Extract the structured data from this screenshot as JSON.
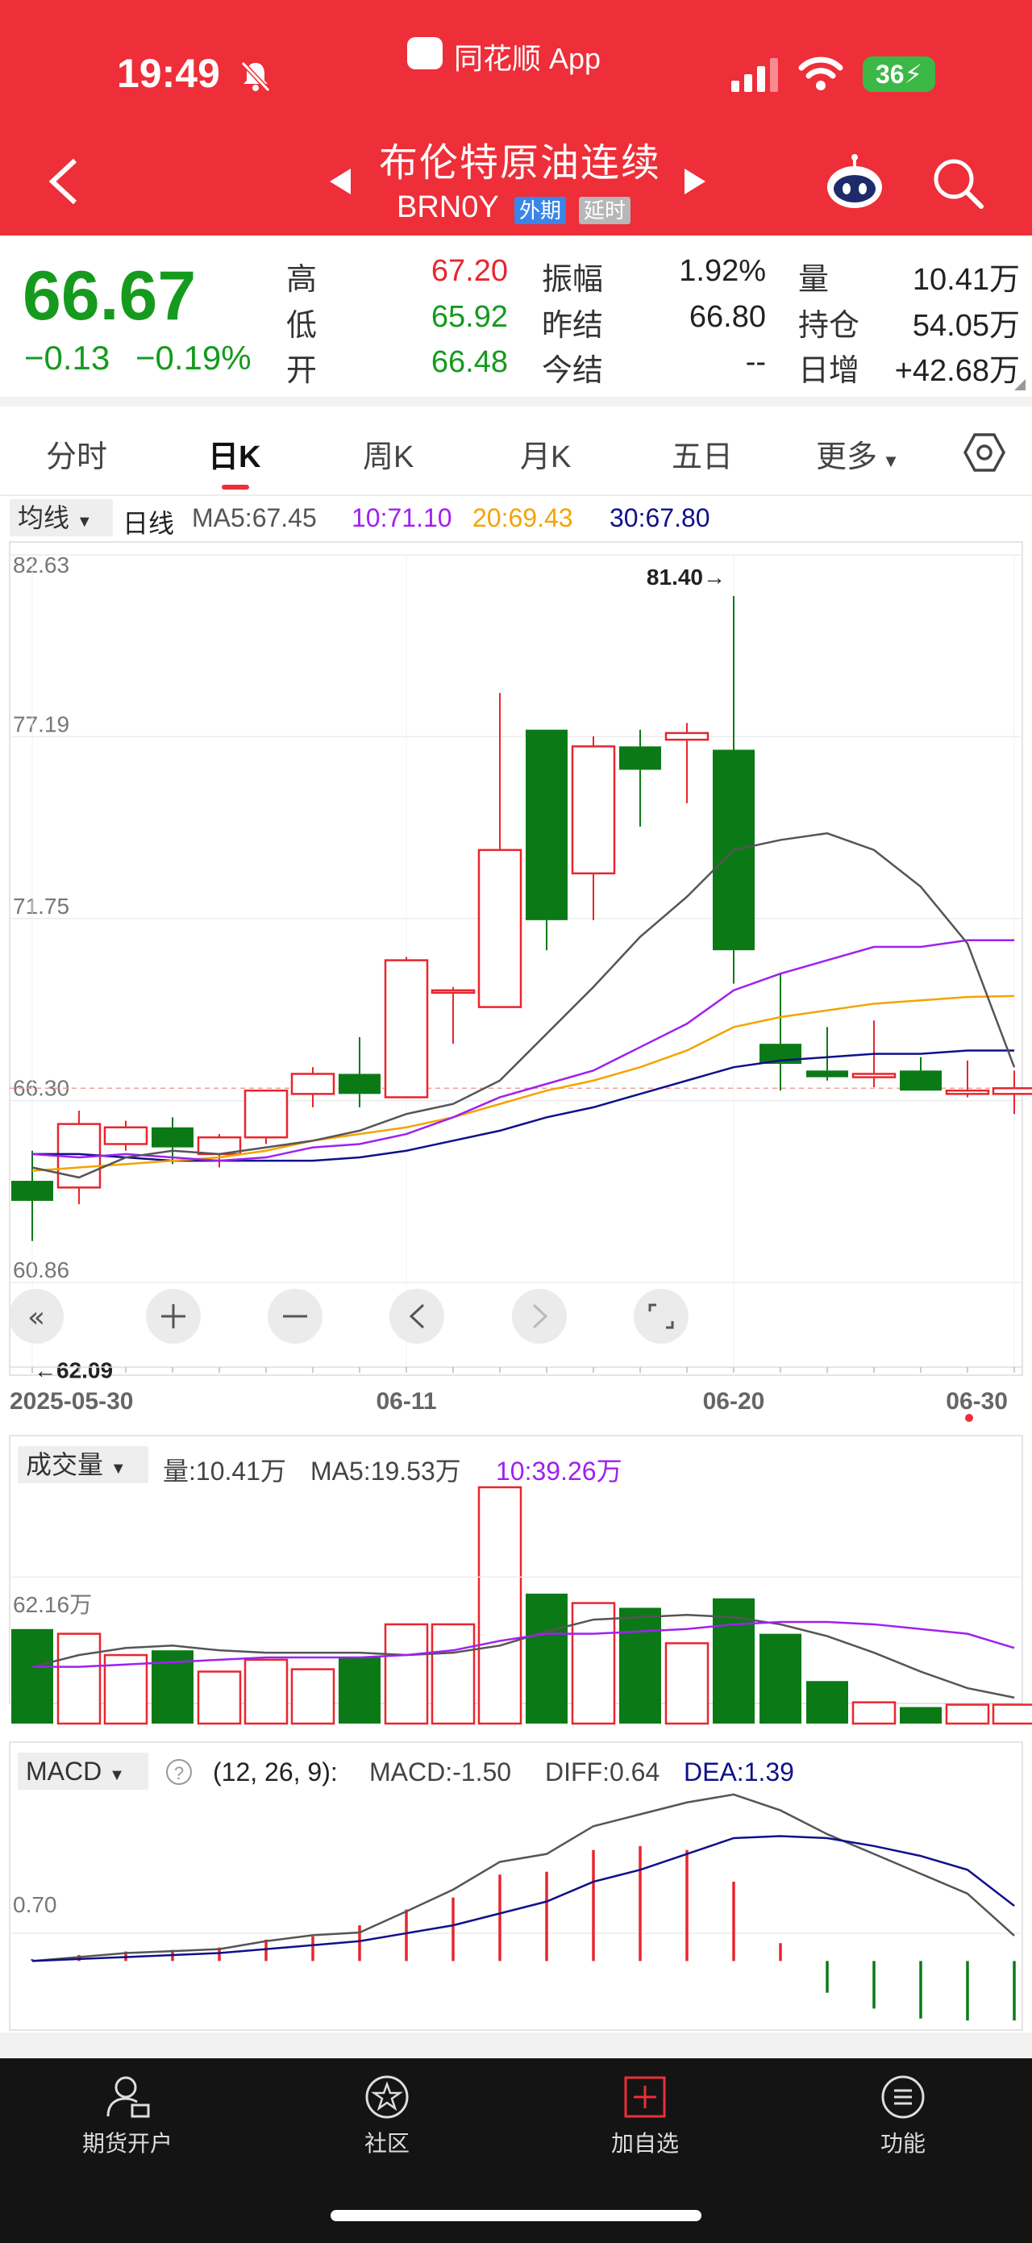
{
  "status_bar": {
    "time": "19:49",
    "app": "同花顺 App",
    "battery": "36"
  },
  "header": {
    "title": "布伦特原油连续",
    "code": "BRN0Y",
    "tag1": "外期",
    "tag2": "延时"
  },
  "quote": {
    "price": "66.67",
    "change": "−0.13",
    "change_pct": "−0.19%",
    "high_label": "高",
    "high": "67.20",
    "low_label": "低",
    "low": "65.92",
    "open_label": "开",
    "open": "66.48",
    "amp_label": "振幅",
    "amp": "1.92%",
    "prev_settle_label": "昨结",
    "prev_settle": "66.80",
    "settle_label": "今结",
    "settle": "--",
    "vol_label": "量",
    "vol": "10.41万",
    "oi_label": "持仓",
    "oi": "54.05万",
    "oi_chg_label": "日增",
    "oi_chg": "+42.68万"
  },
  "tabs": [
    "分时",
    "日K",
    "周K",
    "月K",
    "五日",
    "更多"
  ],
  "main_chart": {
    "indicator": "均线",
    "period": "日线",
    "ma5": "MA5:67.45",
    "ma10": "10:71.10",
    "ma20": "20:69.43",
    "ma30": "30:67.80",
    "y_labels": [
      "82.63",
      "77.19",
      "71.75",
      "66.30",
      "60.86"
    ],
    "max_label": "81.40→",
    "min_label": "←62.09",
    "x_labels": [
      "2025-05-30",
      "06-11",
      "06-20",
      "06-30"
    ]
  },
  "vol_chart": {
    "indicator": "成交量",
    "vol": "量:10.41万",
    "ma5": "MA5:19.53万",
    "ma10": "10:39.26万",
    "y_label": "62.16万"
  },
  "macd_chart": {
    "indicator": "MACD",
    "params": "(12, 26, 9):",
    "macd": "MACD:-1.50",
    "diff": "DIFF:0.64",
    "dea": "DEA:1.39",
    "y_label": "0.70"
  },
  "bottom_nav": [
    "期货开户",
    "社区",
    "加自选",
    "功能"
  ],
  "colors": {
    "up": "#e8262e",
    "down": "#0b7a16",
    "brand": "#ee2e38",
    "ma5": "#555555",
    "ma10": "#a020f0",
    "ma20": "#f5a300",
    "ma30": "#10108a"
  },
  "chart_data": {
    "type": "candlestick",
    "x": [
      "05-30",
      "06-02",
      "06-03",
      "06-04",
      "06-05",
      "06-06",
      "06-09",
      "06-10",
      "06-11",
      "06-12",
      "06-13",
      "06-16",
      "06-17",
      "06-18",
      "06-19",
      "06-20",
      "06-23",
      "06-24",
      "06-25",
      "06-26",
      "06-27",
      "06-30"
    ],
    "candles": [
      {
        "o": 63.9,
        "h": 64.8,
        "l": 62.1,
        "c": 63.3
      },
      {
        "o": 63.7,
        "h": 66.0,
        "l": 63.2,
        "c": 65.6
      },
      {
        "o": 65.0,
        "h": 65.7,
        "l": 64.8,
        "c": 65.5
      },
      {
        "o": 65.5,
        "h": 65.8,
        "l": 64.4,
        "c": 64.9
      },
      {
        "o": 64.7,
        "h": 65.3,
        "l": 64.3,
        "c": 65.2
      },
      {
        "o": 65.2,
        "h": 66.6,
        "l": 65.0,
        "c": 66.6
      },
      {
        "o": 66.5,
        "h": 67.3,
        "l": 66.1,
        "c": 67.1
      },
      {
        "o": 67.1,
        "h": 68.2,
        "l": 66.1,
        "c": 66.5
      },
      {
        "o": 66.4,
        "h": 70.6,
        "l": 66.4,
        "c": 70.5
      },
      {
        "o": 69.6,
        "h": 69.7,
        "l": 68.0,
        "c": 69.6
      },
      {
        "o": 69.1,
        "h": 78.5,
        "l": 69.1,
        "c": 73.8
      },
      {
        "o": 77.4,
        "h": 77.4,
        "l": 70.8,
        "c": 71.7
      },
      {
        "o": 73.1,
        "h": 77.2,
        "l": 71.7,
        "c": 76.9
      },
      {
        "o": 76.9,
        "h": 77.4,
        "l": 74.5,
        "c": 76.2
      },
      {
        "o": 77.1,
        "h": 77.6,
        "l": 75.2,
        "c": 77.3
      },
      {
        "o": 76.8,
        "h": 81.4,
        "l": 69.8,
        "c": 70.8
      },
      {
        "o": 68.0,
        "h": 70.1,
        "l": 66.6,
        "c": 67.4
      },
      {
        "o": 67.2,
        "h": 68.5,
        "l": 66.9,
        "c": 67.0
      },
      {
        "o": 67.0,
        "h": 68.7,
        "l": 66.7,
        "c": 67.1
      },
      {
        "o": 67.2,
        "h": 67.6,
        "l": 66.9,
        "c": 66.6
      },
      {
        "o": 66.5,
        "h": 67.5,
        "l": 66.4,
        "c": 66.6
      },
      {
        "o": 66.5,
        "h": 67.2,
        "l": 65.9,
        "c": 66.67
      }
    ],
    "ma5": [
      64.3,
      64.0,
      64.6,
      64.8,
      64.7,
      64.9,
      65.1,
      65.4,
      65.9,
      66.2,
      66.9,
      68.3,
      69.7,
      71.2,
      72.4,
      73.8,
      74.1,
      74.3,
      73.8,
      72.7,
      71.0,
      67.3
    ],
    "ma10": [
      64.7,
      64.6,
      64.7,
      64.6,
      64.5,
      64.6,
      64.9,
      65.0,
      65.3,
      65.8,
      66.4,
      66.8,
      67.2,
      67.9,
      68.6,
      69.6,
      70.1,
      70.5,
      70.9,
      70.9,
      71.1,
      71.1
    ],
    "ma20": [
      64.2,
      64.3,
      64.4,
      64.5,
      64.6,
      64.8,
      65.1,
      65.3,
      65.5,
      65.8,
      66.2,
      66.6,
      66.9,
      67.3,
      67.8,
      68.5,
      68.8,
      69.0,
      69.2,
      69.3,
      69.4,
      69.43
    ],
    "ma30": [
      64.7,
      64.7,
      64.6,
      64.5,
      64.5,
      64.5,
      64.5,
      64.6,
      64.8,
      65.1,
      65.4,
      65.8,
      66.1,
      66.5,
      66.9,
      67.3,
      67.5,
      67.6,
      67.7,
      67.7,
      67.8,
      67.8
    ],
    "volume": [
      40,
      38,
      29,
      31,
      22,
      27,
      23,
      28,
      42,
      42,
      100,
      55,
      51,
      49,
      34,
      53,
      38,
      18,
      9,
      7,
      8,
      8
    ],
    "vol_ma5": [
      24,
      29,
      32,
      33,
      31,
      30,
      30,
      30,
      29,
      30,
      33,
      39,
      44,
      45,
      46,
      45,
      42,
      37,
      30,
      22,
      15,
      11
    ],
    "vol_ma10": [
      24,
      24,
      25,
      26,
      27,
      28,
      28,
      28,
      29,
      31,
      35,
      38,
      38,
      39,
      40,
      42,
      43,
      43,
      42,
      40,
      38,
      32
    ],
    "macd": [
      0.05,
      0.15,
      0.24,
      0.28,
      0.34,
      0.54,
      0.62,
      0.9,
      1.3,
      1.6,
      2.18,
      2.25,
      2.8,
      2.9,
      2.8,
      2.0,
      0.45,
      -0.8,
      -1.2,
      -1.45,
      -1.5,
      -1.5
    ],
    "diff": [
      0.0,
      0.1,
      0.2,
      0.25,
      0.3,
      0.5,
      0.65,
      0.72,
      1.25,
      1.8,
      2.5,
      2.7,
      3.4,
      3.7,
      4.0,
      4.2,
      3.8,
      3.2,
      2.7,
      2.2,
      1.7,
      0.64
    ],
    "dea": [
      0.0,
      0.05,
      0.1,
      0.15,
      0.2,
      0.3,
      0.4,
      0.5,
      0.7,
      0.9,
      1.2,
      1.5,
      2.0,
      2.3,
      2.7,
      3.1,
      3.15,
      3.1,
      2.9,
      2.65,
      2.3,
      1.39
    ],
    "ylim": [
      60.86,
      82.63
    ]
  }
}
